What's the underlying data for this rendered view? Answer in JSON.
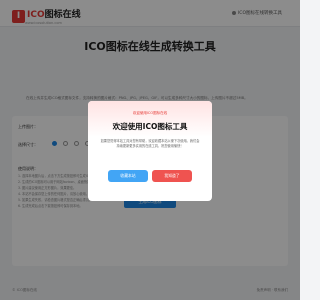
{
  "header": {
    "logo_mark": "I",
    "logo_ico": "ICO",
    "logo_text": "图标在线",
    "logo_sub": "www.icosolution.com",
    "right_link": "ICO图标在线转换工具"
  },
  "main": {
    "title": "ICO图标在线生成转换工具",
    "description": "在线上传并生成ICO格式图标文件，支持转换的图片格式：PNG、JPG、JPEG、GIF，可以生成多种尺寸大小的图标，上传图片不超过5MB。",
    "file_label": "上传图片：",
    "size_label": "选择尺寸：",
    "notes_title": "使用说明：",
    "notes": [
      "1. 选择本地图片后，点击下方生成按钮即可生成ICO图标。",
      "2. 生成的ICO图标可以用于网站favicon、桌面快捷方式等。",
      "3. 图片建议使用正方形图片，效果更佳。",
      "4. 本站不会保存您上传的任何图片，请放心使用。",
      "5. 如果生成失败，请检查图片格式是否正确后重试。",
      "6. 生成完成后点击下载按钮即可保存到本地。"
    ],
    "convert_button": "生成ICO图标"
  },
  "footer": {
    "left": "© ICO图标在线",
    "right": "免责声明 · 联系我们"
  },
  "modal": {
    "eyebrow": "欢迎使用ICO图标在线",
    "title": "欢迎使用ICO图标工具",
    "body": "如果您觉得本站工具对您有帮助，欢迎收藏本站以便下次使用。我们会持续更新更多实用的在线工具，祝您使用愉快！",
    "bookmark_button": "收藏本站",
    "open_button": "我知道了"
  },
  "colors": {
    "brand": "#e53935",
    "primary": "#1e88e5",
    "modal_bookmark": "#42a5f5",
    "modal_open": "#ef5350"
  }
}
